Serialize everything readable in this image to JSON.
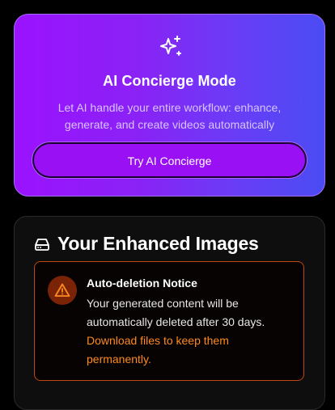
{
  "concierge": {
    "icon": "sparkles-icon",
    "title": "AI Concierge Mode",
    "description": "Let AI handle your entire workflow: enhance, generate, and create videos automatically",
    "button_label": "Try AI Concierge",
    "gradient_colors": [
      "#9b12ff",
      "#4a4cf3"
    ]
  },
  "images_panel": {
    "icon": "hard-drive-icon",
    "title": "Your Enhanced Images",
    "notice": {
      "icon": "warning-triangle-icon",
      "title": "Auto-deletion Notice",
      "body": "Your generated content will be automatically deleted after 30 days. ",
      "link_text": "Download files to keep them permanently.",
      "accent_color": "#ff8a1e"
    }
  }
}
